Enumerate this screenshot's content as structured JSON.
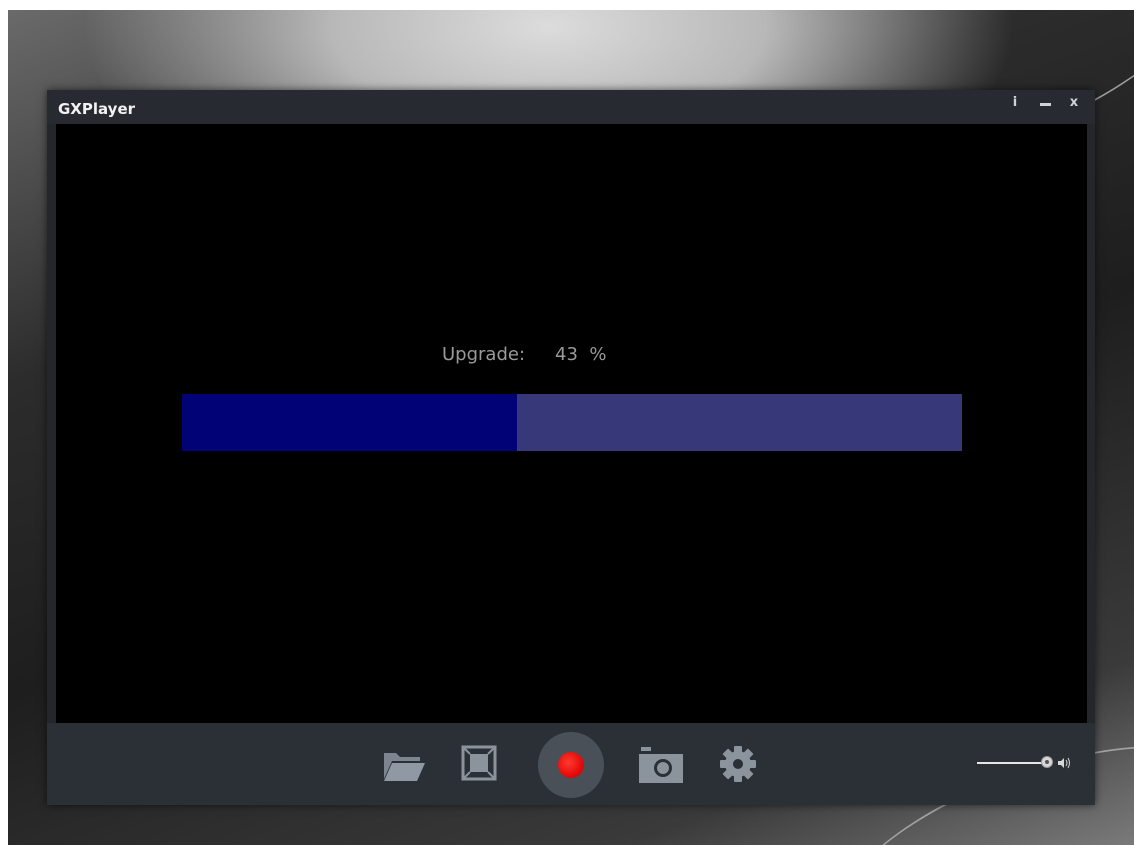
{
  "window": {
    "title": "GXPlayer",
    "controls": {
      "info": "i",
      "close": "x"
    }
  },
  "upgrade": {
    "label": "Upgrade:",
    "percent_text": "43  %",
    "progress": 0.43,
    "fill_color": "#020277",
    "track_color": "#363879"
  },
  "toolbar": {
    "icons": [
      "folder-open-icon",
      "fullscreen-icon",
      "record-icon",
      "camera-icon",
      "gear-icon",
      "volume-icon"
    ],
    "record_color": "#e50b0b"
  },
  "volume": {
    "level": 0.9
  }
}
